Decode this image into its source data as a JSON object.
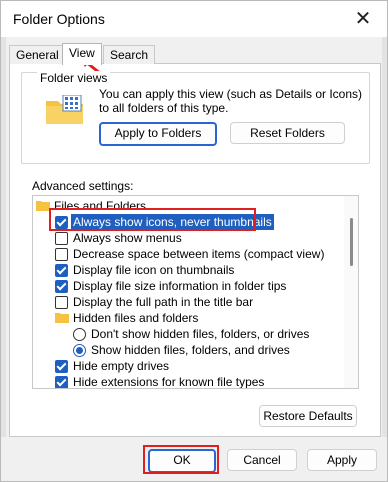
{
  "window": {
    "title": "Folder Options"
  },
  "tabs": [
    {
      "label": "General"
    },
    {
      "label": "View"
    },
    {
      "label": "Search"
    }
  ],
  "folder_views": {
    "legend": "Folder views",
    "description": "You can apply this view (such as Details or Icons) to all folders of this type.",
    "apply_button": "Apply to Folders",
    "reset_button": "Reset Folders"
  },
  "advanced": {
    "label": "Advanced settings:",
    "items": [
      {
        "label": "Files and Folders",
        "kind": "folder"
      },
      {
        "label": "Always show icons, never thumbnails",
        "kind": "checkbox",
        "checked": true
      },
      {
        "label": "Always show menus",
        "kind": "checkbox",
        "checked": false
      },
      {
        "label": "Decrease space between items (compact view)",
        "kind": "checkbox",
        "checked": false
      },
      {
        "label": "Display file icon on thumbnails",
        "kind": "checkbox",
        "checked": true
      },
      {
        "label": "Display file size information in folder tips",
        "kind": "checkbox",
        "checked": true
      },
      {
        "label": "Display the full path in the title bar",
        "kind": "checkbox",
        "checked": false
      },
      {
        "label": "Hidden files and folders",
        "kind": "folder"
      },
      {
        "label": "Don't show hidden files, folders, or drives",
        "kind": "radio",
        "checked": false
      },
      {
        "label": "Show hidden files, folders, and drives",
        "kind": "radio",
        "checked": true
      },
      {
        "label": "Hide empty drives",
        "kind": "checkbox",
        "checked": true
      },
      {
        "label": "Hide extensions for known file types",
        "kind": "checkbox",
        "checked": true
      }
    ]
  },
  "restore_button": "Restore Defaults",
  "footer": {
    "ok": "OK",
    "cancel": "Cancel",
    "apply": "Apply"
  },
  "icons": {
    "close": "close-icon",
    "folder": "folder-icon"
  },
  "colors": {
    "accent": "#1e5fbf",
    "annotation": "#e02020"
  }
}
